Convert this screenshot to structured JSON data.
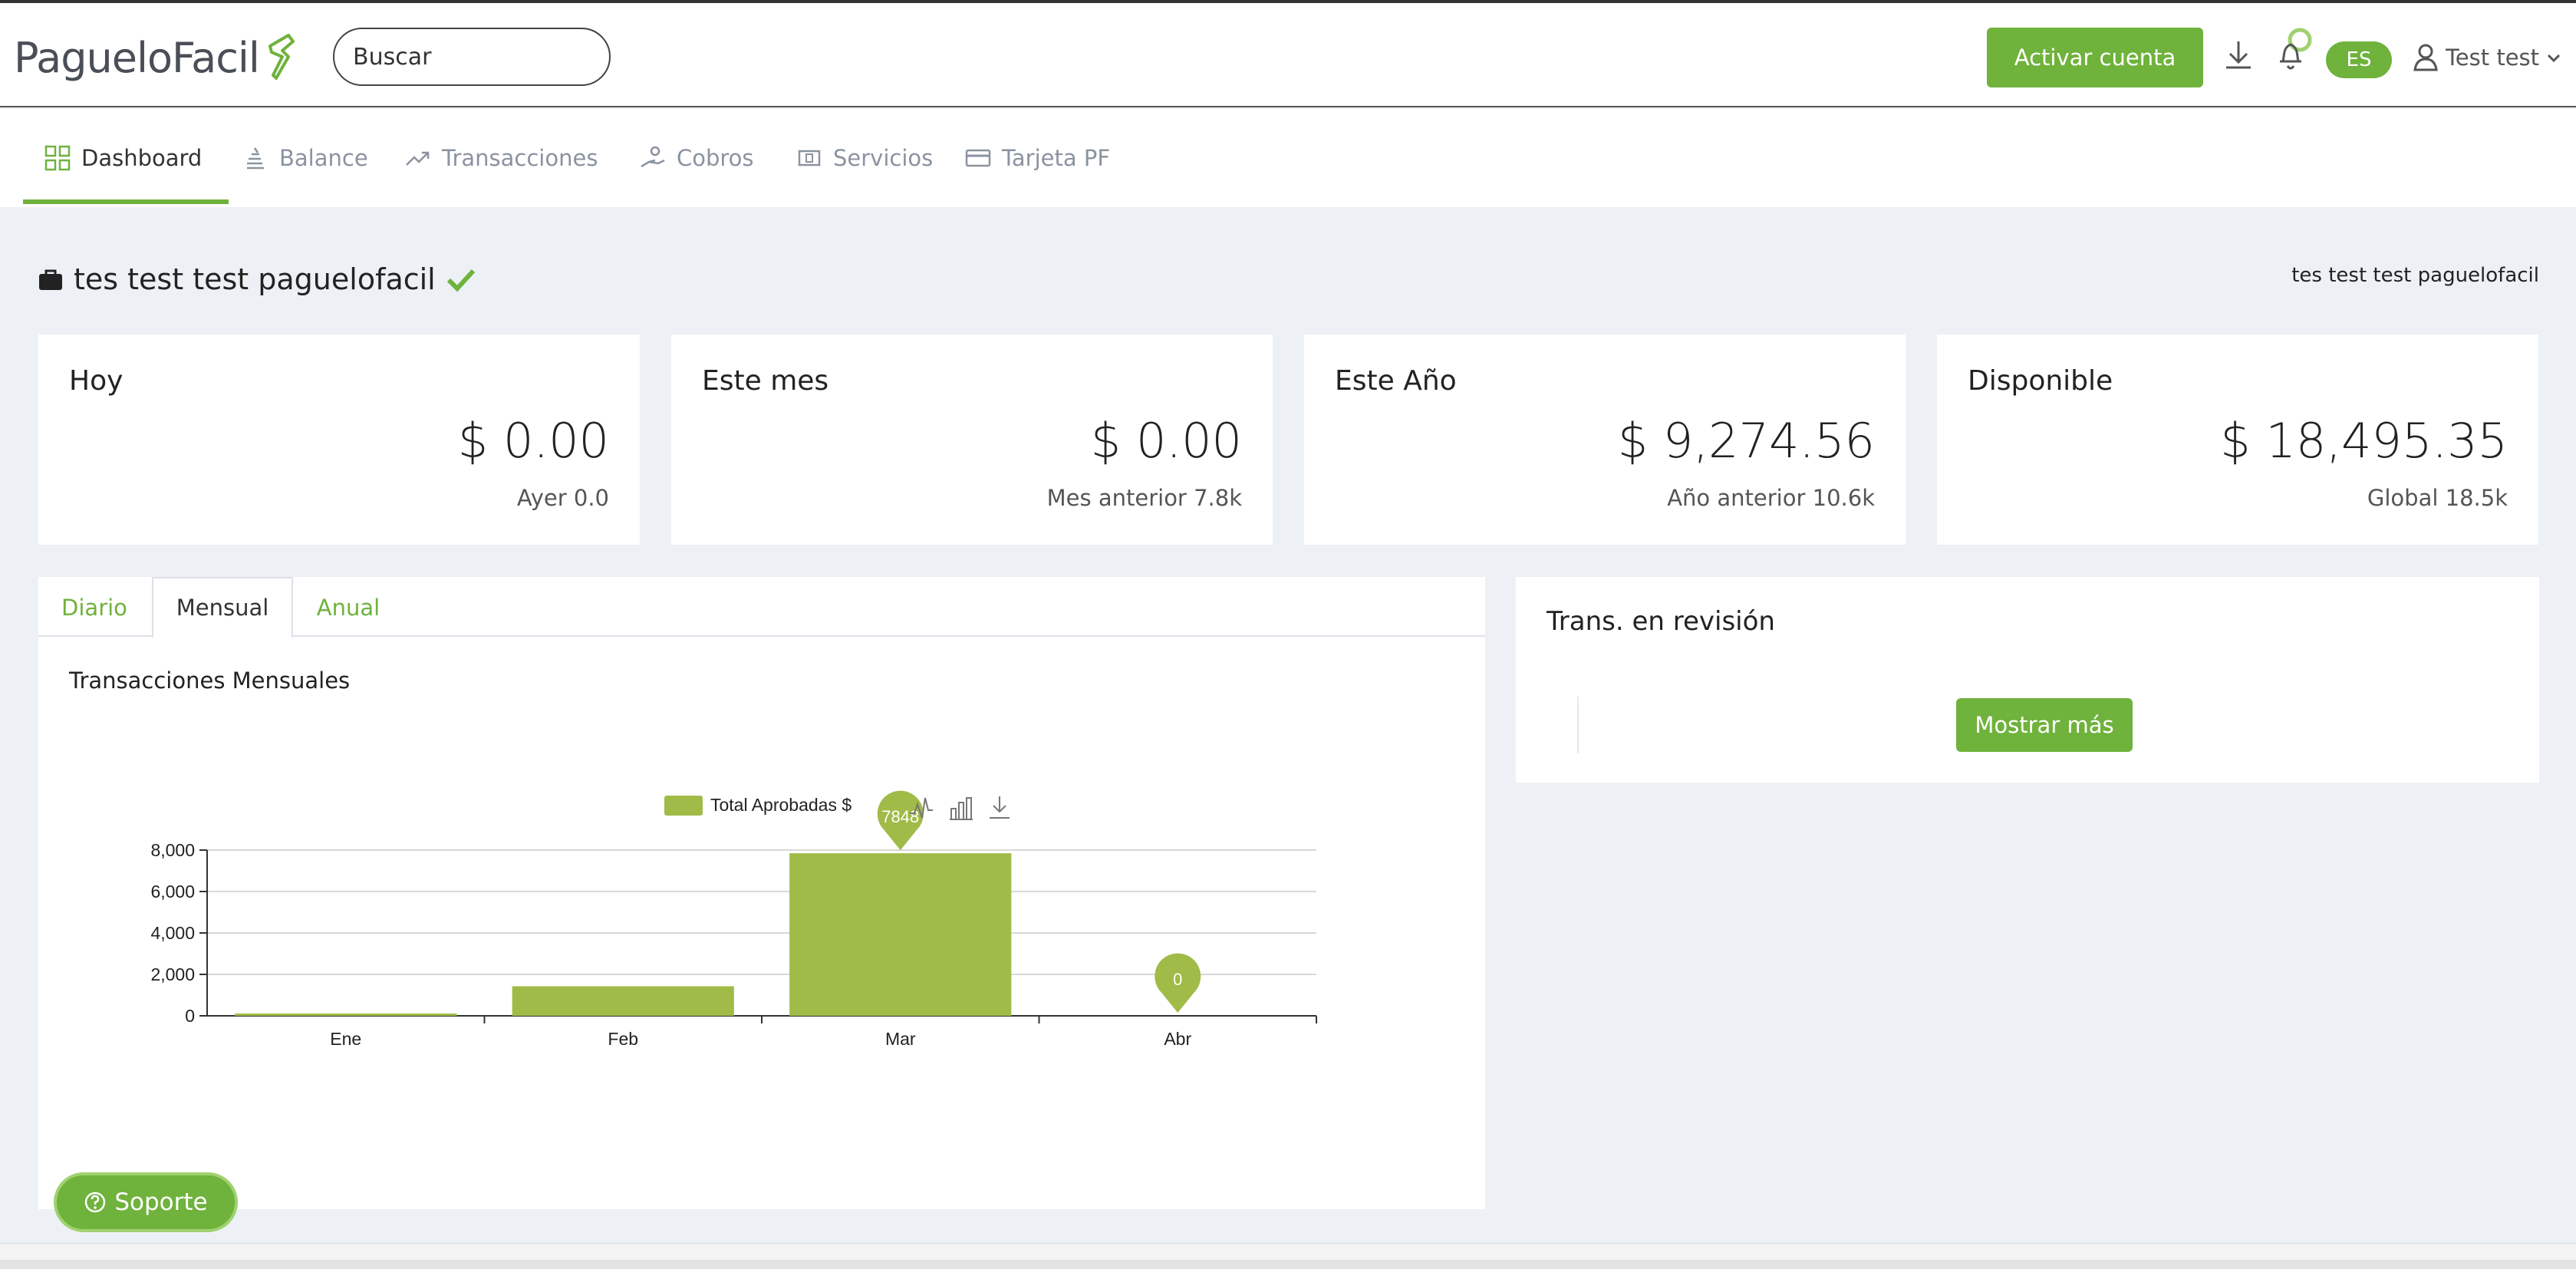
{
  "colors": {
    "accent": "#6fb23c",
    "bar": "#a0bb47"
  },
  "header": {
    "logo_text": "PagueloFacil",
    "search_placeholder": "Buscar",
    "activate_label": "Activar cuenta",
    "language": "ES",
    "user_name": "Test test",
    "icons": [
      "download-icon",
      "bell-icon",
      "user-icon",
      "chevron-down-icon"
    ]
  },
  "nav": {
    "items": [
      {
        "label": "Dashboard",
        "icon": "grid-icon",
        "active": true
      },
      {
        "label": "Balance",
        "icon": "coins-icon"
      },
      {
        "label": "Transacciones",
        "icon": "trend-icon"
      },
      {
        "label": "Cobros",
        "icon": "hand-coin-icon"
      },
      {
        "label": "Servicios",
        "icon": "bill-icon"
      },
      {
        "label": "Tarjeta PF",
        "icon": "card-icon"
      }
    ]
  },
  "company": {
    "name": "tes test test paguelofacil",
    "right_label": "tes test test paguelofacil"
  },
  "cards": [
    {
      "title": "Hoy",
      "amount": "$ 0.00",
      "sub": "Ayer 0.0"
    },
    {
      "title": "Este mes",
      "amount": "$ 0.00",
      "sub": "Mes anterior 7.8k"
    },
    {
      "title": "Este Año",
      "amount": "$ 9,274.56",
      "sub": "Año anterior 10.6k"
    },
    {
      "title": "Disponible",
      "amount": "$ 18,495.35",
      "sub": "Global 18.5k"
    }
  ],
  "tabs": [
    {
      "label": "Diario"
    },
    {
      "label": "Mensual",
      "active": true
    },
    {
      "label": "Anual"
    }
  ],
  "chart_data": {
    "type": "bar",
    "title": "Transacciones Mensuales",
    "categories": [
      "Ene",
      "Feb",
      "Mar",
      "Abr"
    ],
    "series": [
      {
        "name": "Total Aprobadas $",
        "values": [
          60,
          1426,
          7848,
          0
        ]
      }
    ],
    "ylim": [
      0,
      8000
    ],
    "yticks": [
      "0",
      "2,000",
      "4,000",
      "6,000",
      "8,000"
    ],
    "markers": [
      {
        "category": "Mar",
        "label": "7848"
      },
      {
        "category": "Abr",
        "label": "0"
      }
    ],
    "grid": true,
    "legend_position": "top",
    "toolbox_icons": [
      "line-chart-icon",
      "bar-chart-icon",
      "save-image-icon"
    ]
  },
  "review": {
    "title": "Trans. en revisión",
    "more_label": "Mostrar más"
  },
  "support": {
    "label": "Soporte"
  }
}
